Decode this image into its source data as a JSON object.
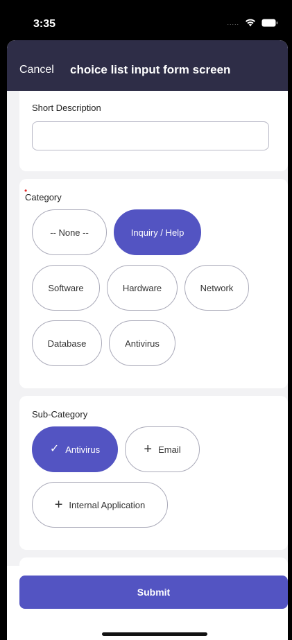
{
  "status_bar": {
    "time": "3:35",
    "signal": "....."
  },
  "nav": {
    "cancel_label": "Cancel",
    "title": "choice list input form screen"
  },
  "short_description": {
    "label": "Short Description",
    "value": ""
  },
  "category": {
    "label": "Category",
    "required_marker": "•",
    "options": [
      "-- None --",
      "Inquiry / Help",
      "Software",
      "Hardware",
      "Network",
      "Database",
      "Antivirus"
    ],
    "selected": "Inquiry / Help"
  },
  "sub_category": {
    "label": "Sub-Category",
    "options": [
      "Antivirus",
      "Email",
      "Internal Application"
    ],
    "selected": "Antivirus",
    "selected_icon": "✓",
    "add_icon": "+"
  },
  "submit_label": "Submit",
  "colors": {
    "accent": "#5354c2",
    "header": "#2e2d47",
    "required": "#e32b2b"
  }
}
